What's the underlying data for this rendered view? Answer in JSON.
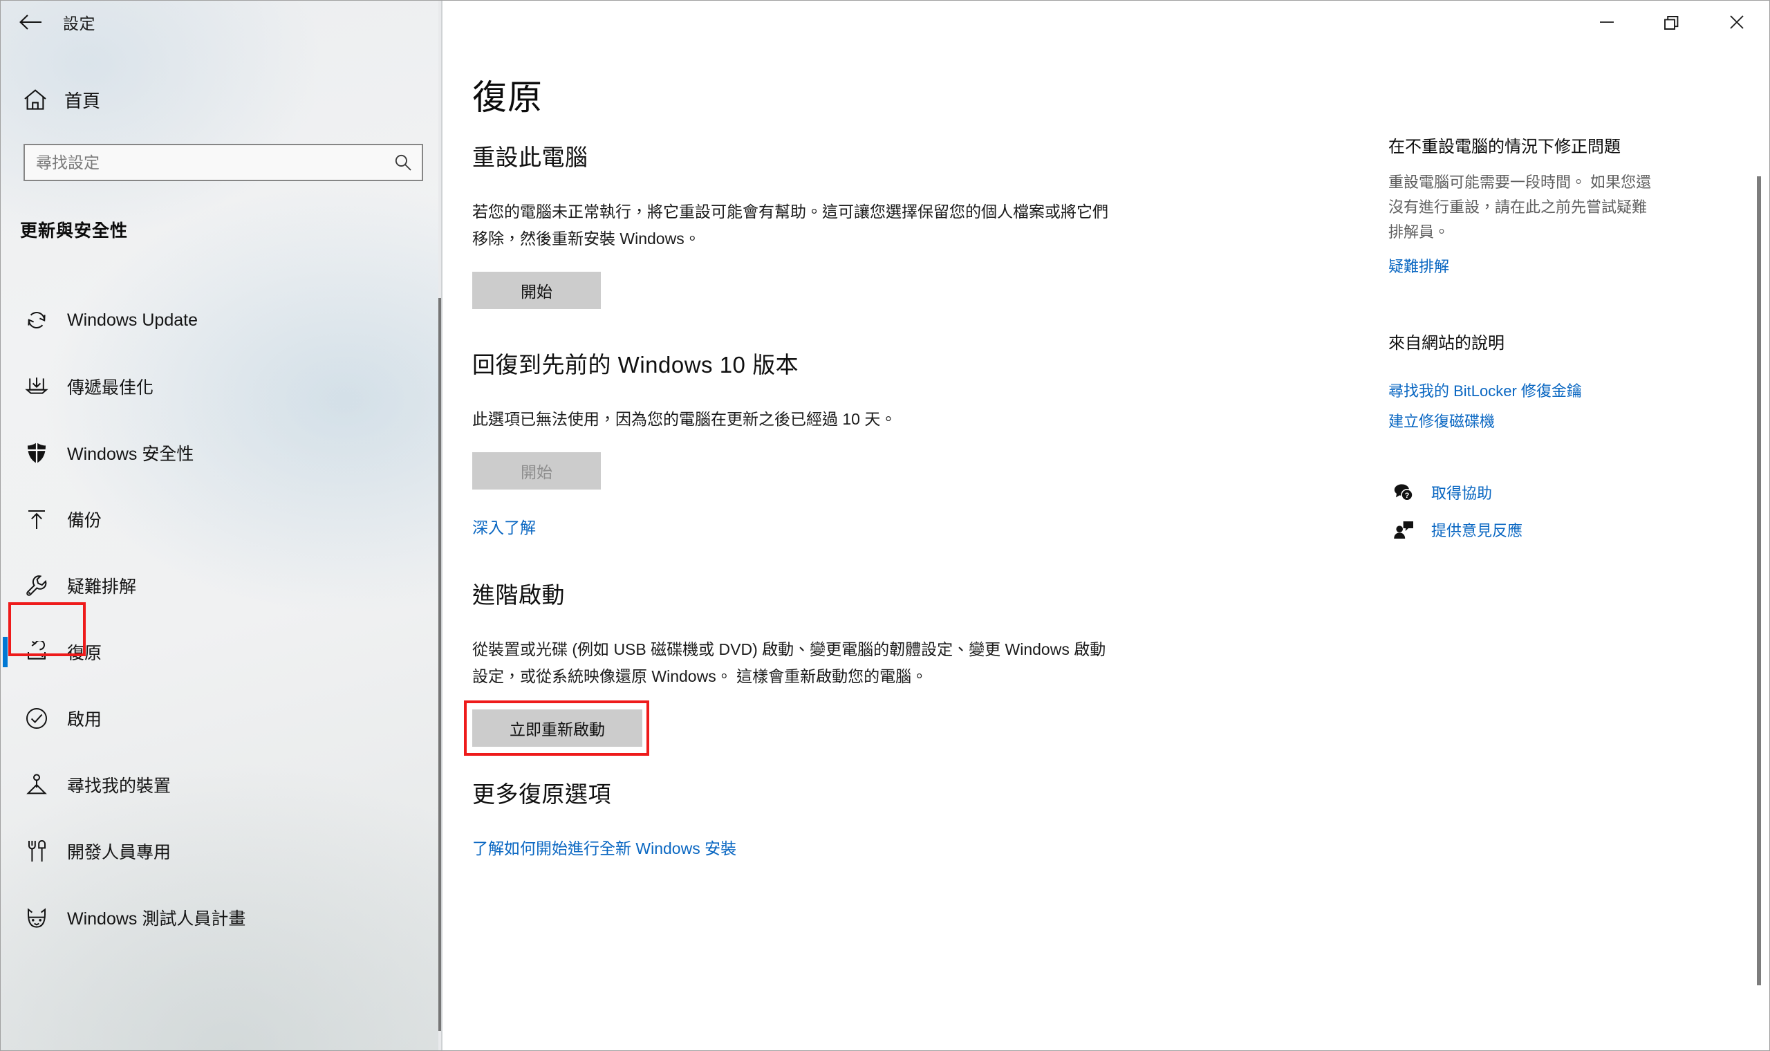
{
  "window": {
    "title": "設定",
    "back_label": "←",
    "controls": {
      "minimize": "minimize",
      "maximize": "restore",
      "close": "close"
    }
  },
  "sidebar": {
    "home_label": "首頁",
    "search": {
      "placeholder": "尋找設定",
      "value": ""
    },
    "group_header": "更新與安全性",
    "items": [
      {
        "label": "Windows Update",
        "icon": "sync-icon",
        "selected": false
      },
      {
        "label": "傳遞最佳化",
        "icon": "delivery-optimization-icon",
        "selected": false
      },
      {
        "label": "Windows 安全性",
        "icon": "shield-icon",
        "selected": false
      },
      {
        "label": "備份",
        "icon": "upload-arrow-icon",
        "selected": false
      },
      {
        "label": "疑難排解",
        "icon": "wrench-icon",
        "selected": false
      },
      {
        "label": "復原",
        "icon": "recovery-icon",
        "selected": true
      },
      {
        "label": "啟用",
        "icon": "check-circle-icon",
        "selected": false
      },
      {
        "label": "尋找我的裝置",
        "icon": "find-my-device-icon",
        "selected": false
      },
      {
        "label": "開發人員專用",
        "icon": "developer-tools-icon",
        "selected": false
      },
      {
        "label": "Windows 測試人員計畫",
        "icon": "insider-cat-icon",
        "selected": false
      }
    ]
  },
  "main": {
    "page_title": "復原",
    "sections": [
      {
        "title": "重設此電腦",
        "body": "若您的電腦未正常執行，將它重設可能會有幫助。這可讓您選擇保留您的個人檔案或將它們移除，然後重新安裝 Windows。",
        "button": "開始",
        "button_disabled": false
      },
      {
        "title": "回復到先前的 Windows 10 版本",
        "body": "此選項已無法使用，因為您的電腦在更新之後已經過 10 天。",
        "button": "開始",
        "button_disabled": true,
        "link": "深入了解"
      },
      {
        "title": "進階啟動",
        "body": "從裝置或光碟 (例如 USB 磁碟機或 DVD) 啟動、變更電腦的韌體設定、變更 Windows 啟動設定，或從系統映像還原 Windows。 這樣會重新啟動您的電腦。",
        "button": "立即重新啟動",
        "button_disabled": false
      },
      {
        "title": "更多復原選項",
        "link": "了解如何開始進行全新 Windows 安裝"
      }
    ]
  },
  "aside": {
    "block1": {
      "title": "在不重設電腦的情況下修正問題",
      "body": "重設電腦可能需要一段時間。 如果您還沒有進行重設，請在此之前先嘗試疑難排解員。",
      "link": "疑難排解"
    },
    "block2": {
      "title": "來自網站的說明",
      "links": [
        "尋找我的 BitLocker 修復金鑰",
        "建立修復磁碟機"
      ]
    },
    "block3": {
      "links": [
        {
          "label": "取得協助",
          "icon": "help-chat-icon"
        },
        {
          "label": "提供意見反應",
          "icon": "feedback-person-icon"
        }
      ]
    }
  },
  "colors": {
    "accent": "#0078d4",
    "link": "#0a67c2",
    "annotation": "#ee1b1b",
    "button_face": "#cccccc"
  }
}
